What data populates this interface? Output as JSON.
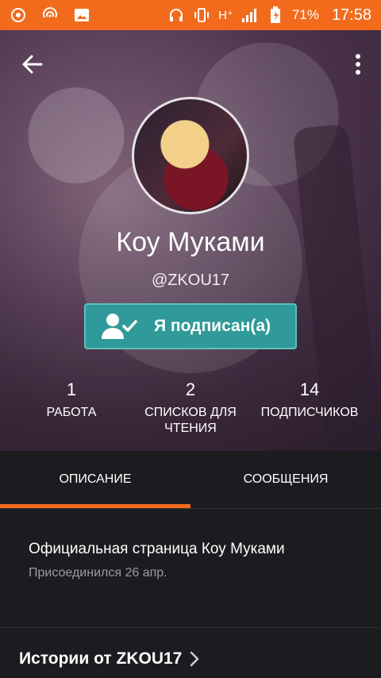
{
  "status_bar": {
    "battery": "71%",
    "time": "17:58",
    "network": "H⁺"
  },
  "profile": {
    "name": "Коу Муками",
    "handle": "@ZKOU17",
    "follow_label": "Я подписан(а)"
  },
  "stats": [
    {
      "value": "1",
      "label": "РАБОТА"
    },
    {
      "value": "2",
      "label": "СПИСКОВ ДЛЯ ЧТЕНИЯ"
    },
    {
      "value": "14",
      "label": "ПОДПИСЧИКОВ"
    }
  ],
  "tabs": [
    {
      "label": "ОПИСАНИЕ",
      "active": true
    },
    {
      "label": "СООБЩЕНИЯ",
      "active": false
    }
  ],
  "about": {
    "title": "Официальная страница Коу Муками",
    "joined": "Присоединился 26 апр."
  },
  "stories": {
    "label": "Истории от ZKOU17"
  },
  "colors": {
    "accent": "#f26b1d",
    "follow_button": "#2f9a99",
    "background": "#1c1b1f"
  }
}
